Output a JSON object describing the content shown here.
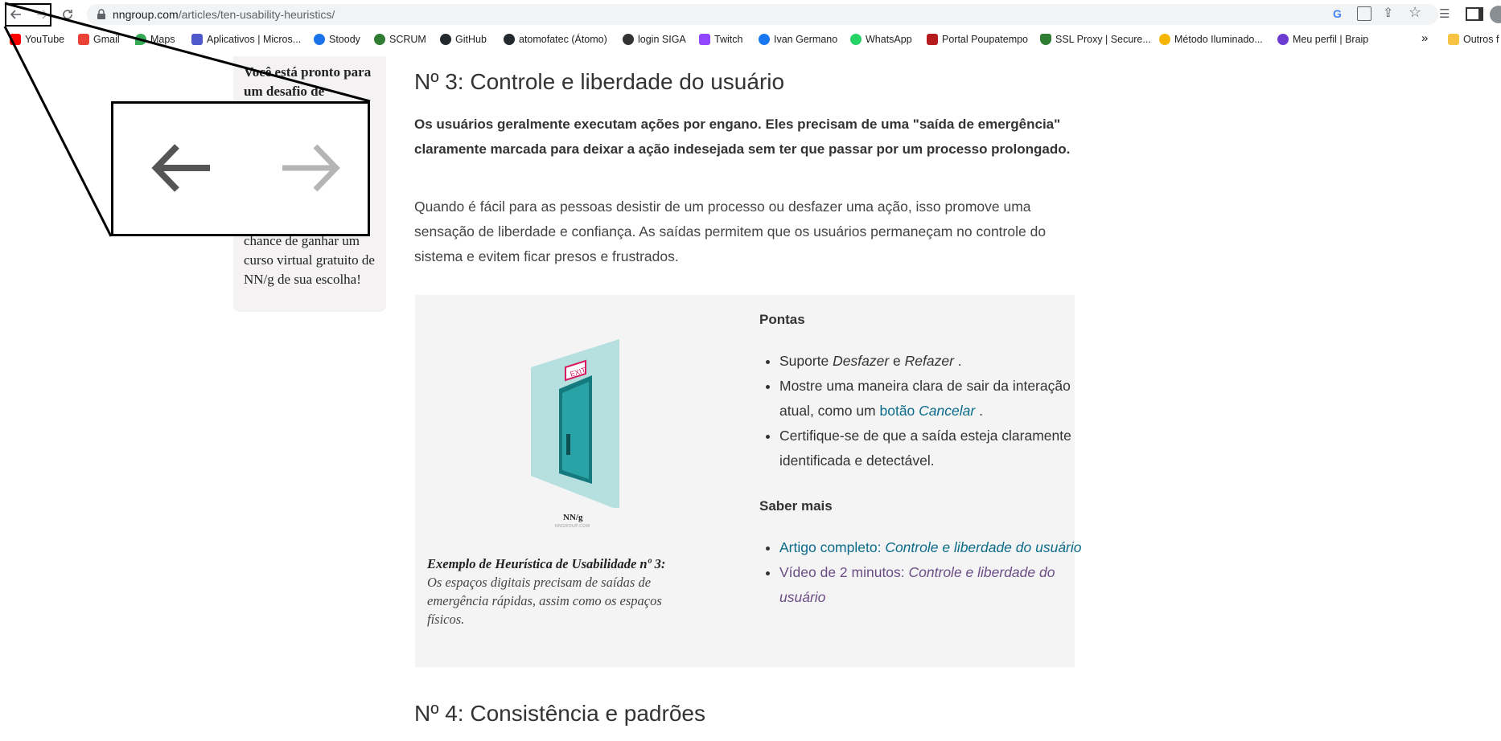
{
  "browser": {
    "url_host": "nngroup.com",
    "url_path": "/articles/ten-usability-heuristics/",
    "bookmarks": [
      {
        "label": "YouTube",
        "color": "#ff0000"
      },
      {
        "label": "Gmail",
        "color": "#ea4335"
      },
      {
        "label": "Maps",
        "color": "#34a853"
      },
      {
        "label": "Aplicativos | Micros...",
        "color": "#5059c9"
      },
      {
        "label": "Stoody",
        "color": "#1a73e8"
      },
      {
        "label": "SCRUM",
        "color": "#2e7d32"
      },
      {
        "label": "GitHub",
        "color": "#24292e"
      },
      {
        "label": "atomofatec (Átomo)",
        "color": "#24292e"
      },
      {
        "label": "login SIGA",
        "color": "#333333"
      },
      {
        "label": "Twitch",
        "color": "#9146ff"
      },
      {
        "label": "Ivan Germano",
        "color": "#1877f2"
      },
      {
        "label": "WhatsApp",
        "color": "#25d366"
      },
      {
        "label": "Portal Poupatempo",
        "color": "#b71c1c"
      },
      {
        "label": "SSL Proxy | Secure...",
        "color": "#2e7d32"
      },
      {
        "label": "Método Iluminado...",
        "color": "#f4b400"
      },
      {
        "label": "Meu perfil | Braip",
        "color": "#6c3bd1"
      }
    ],
    "overflow": "»",
    "other_bookmarks": "Outros f"
  },
  "sidebar": {
    "title": "Você está pronto para um desafio de",
    "body": "chance de ganhar um curso virtual gratuito de NN/g de sua escolha!"
  },
  "section3": {
    "heading": "Nº 3: Controle e liberdade do usuário",
    "lead": "Os usuários geralmente executam ações por engano. Eles precisam de uma \"saída de emergência\" claramente marcada para deixar a ação indesejada sem ter que passar por um processo prolongado.",
    "body": "Quando é fácil para as pessoas desistir de um processo ou desfazer uma ação, isso promove uma sensação de liberdade e confiança. As saídas permitem que os usuários permaneçam no controle do sistema e evitem ficar presos e frustrados.",
    "image": {
      "exit_sign": "EXIT",
      "logo": "NN/g",
      "logo_sub": "NNGROUP.COM"
    },
    "caption_title": "Exemplo de Heurística de Usabilidade nº 3:",
    "caption_text": "Os espaços digitais precisam de saídas de emergência rápidas, assim como os espaços físicos.",
    "tips_heading": "Pontas",
    "tip1_a": "Suporte ",
    "tip1_b": "Desfazer",
    "tip1_c": " e ",
    "tip1_d": "Refazer",
    "tip1_e": " .",
    "tip2_a": "Mostre uma maneira clara de sair da interação atual, como um ",
    "tip2_link_a": "botão ",
    "tip2_link_b": "Cancelar",
    "tip2_e": " .",
    "tip3": "Certifique-se de que a saída esteja claramente identificada e detectável.",
    "learn_heading": "Saber mais",
    "learn1_a": "Artigo completo: ",
    "learn1_b": "Controle e liberdade do usuário",
    "learn2_a": "Vídeo de 2 minutos: ",
    "learn2_b": "Controle e liberdade do usuário"
  },
  "section4": {
    "heading": "Nº 4: Consistência e padrões"
  },
  "colors": {
    "link": "#0b6b8a",
    "visited_link": "#6b4d86",
    "door_teal": "#2aa3a6",
    "wall": "#b6e0e0",
    "exit_sign": "#d81b60"
  }
}
